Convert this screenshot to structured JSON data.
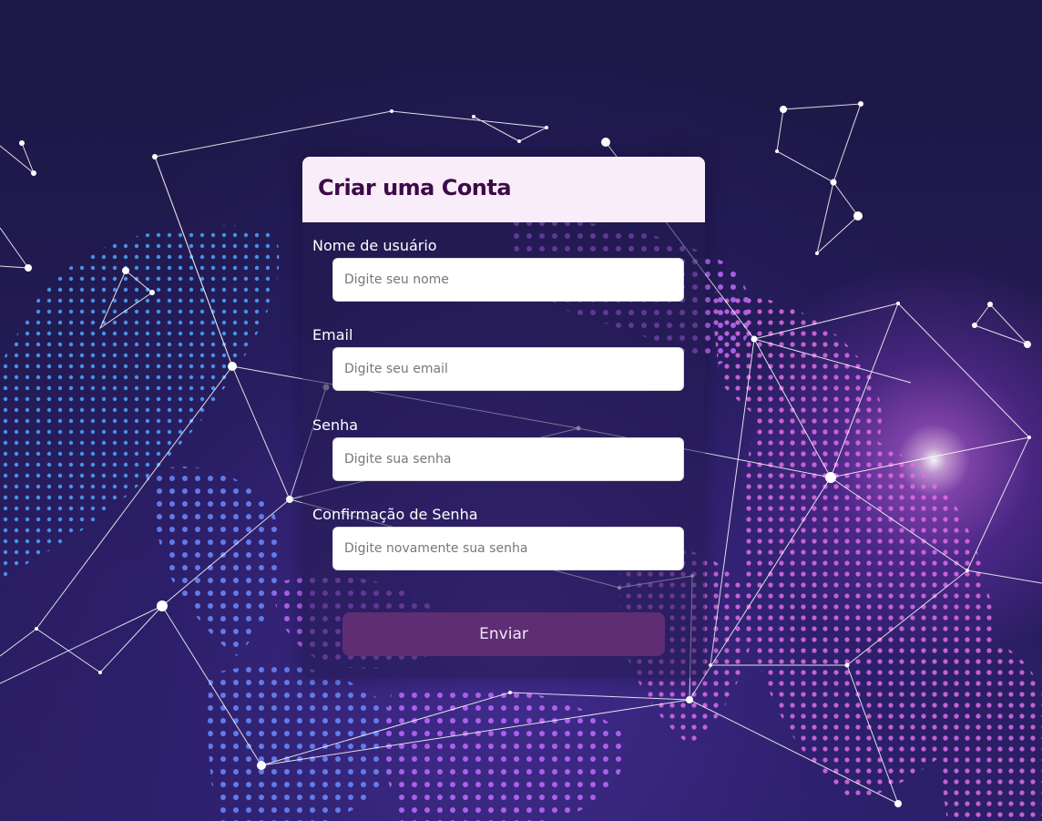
{
  "form": {
    "title": "Criar uma Conta",
    "fields": [
      {
        "label": "Nome de usuário",
        "placeholder": "Digite seu nome",
        "type": "text",
        "value": ""
      },
      {
        "label": "Email",
        "placeholder": "Digite seu email",
        "type": "email",
        "value": ""
      },
      {
        "label": "Senha",
        "placeholder": "Digite sua senha",
        "type": "password",
        "value": ""
      },
      {
        "label": "Confirmação de Senha",
        "placeholder": "Digite novamente sua senha",
        "type": "password",
        "value": ""
      }
    ],
    "submit_label": "Enviar"
  },
  "colors": {
    "header_background": "#f8edf8",
    "title_text": "#3e0a4a",
    "button_background": "#5f2d74",
    "page_background": "#1c1744",
    "glow_accent": "#c86bff"
  }
}
